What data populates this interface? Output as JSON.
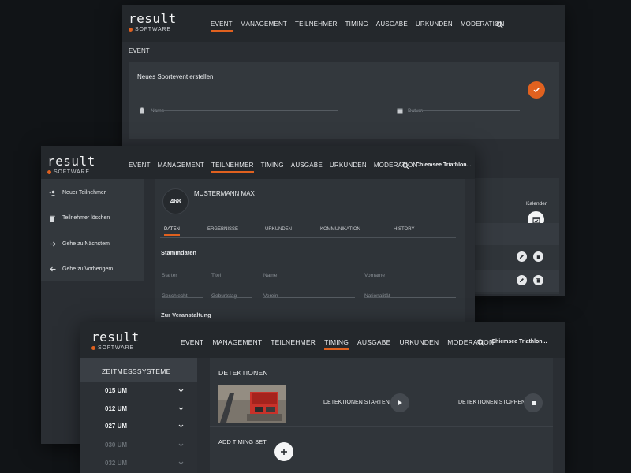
{
  "brand": {
    "name": "result",
    "sub": "SOFTWARE",
    "accent": "#e0611f"
  },
  "window1": {
    "nav": [
      "EVENT",
      "MANAGEMENT",
      "TEILNEHMER",
      "TIMING",
      "AUSGABE",
      "URKUNDEN",
      "MODERATION"
    ],
    "active_nav": "EVENT",
    "section": "EVENT",
    "card_title": "Neues Sportevent erstellen",
    "fields": {
      "name_placeholder": "Name",
      "date_placeholder": "Datum"
    },
    "confirm_icon": "check-icon",
    "calendar_label": "Kalender"
  },
  "window2": {
    "nav": [
      "EVENT",
      "MANAGEMENT",
      "TEILNEHMER",
      "TIMING",
      "AUSGABE",
      "URKUNDEN",
      "MODERATION"
    ],
    "active_nav": "TEILNEHMER",
    "event_name": "Chiemsee Triathlon...",
    "sidebar": [
      {
        "label": "Neuer Teilnehmer",
        "icon": "add-person-icon"
      },
      {
        "label": "Teilnehmer löschen",
        "icon": "trash-icon"
      },
      {
        "label": "Gehe zu Nächstem",
        "icon": "arrow-right-icon"
      },
      {
        "label": "Gehe zu Vorherigem",
        "icon": "arrow-left-icon"
      }
    ],
    "bib": "468",
    "person": "MUSTERMANN MAX",
    "tabs": [
      "DATEN",
      "ERGEBNISSE",
      "URKUNDEN",
      "KOMMUNIKATION",
      "HISTORY"
    ],
    "active_tab": "DATEN",
    "stammdaten_title": "Stammdaten",
    "row1": [
      "Starter",
      "Titel",
      "Name",
      "Vorname"
    ],
    "row2": [
      "Geschlecht",
      "Geburtstag",
      "Verein",
      "Nationalität"
    ],
    "zur_veranstaltung": "Zur Veranstaltung"
  },
  "window3": {
    "nav": [
      "EVENT",
      "MANAGEMENT",
      "TEILNEHMER",
      "TIMING",
      "AUSGABE",
      "URKUNDEN",
      "MODERATION"
    ],
    "active_nav": "TIMING",
    "event_name": "Chiemsee Triathlon...",
    "sidebar_title": "ZEITMESSSYSTEME",
    "systems": [
      "015 UM",
      "012 UM",
      "027 UM",
      "030 UM",
      "032 UM"
    ],
    "detections_title": "DETEKTIONEN",
    "start_label": "DETEKTIONEN STARTEN",
    "stop_label": "DETEKTIONEN STOPPEN",
    "add_label": "ADD TIMING SET"
  }
}
